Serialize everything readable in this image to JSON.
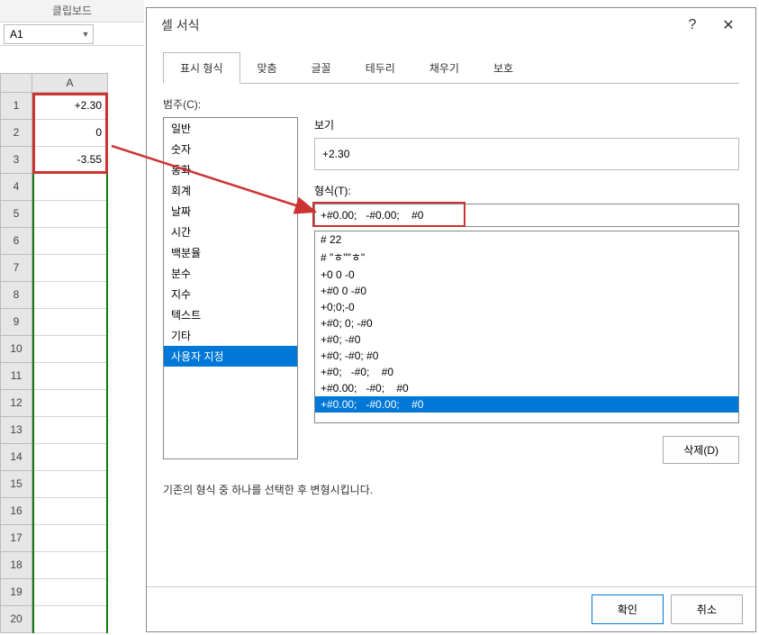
{
  "ribbon": {
    "clipboard_label": "클립보드"
  },
  "namebox": {
    "value": "A1"
  },
  "grid": {
    "col_header": "A",
    "rows": [
      "1",
      "2",
      "3",
      "4",
      "5",
      "6",
      "7",
      "8",
      "9",
      "10",
      "11",
      "12",
      "13",
      "14",
      "15",
      "16",
      "17",
      "18",
      "19",
      "20"
    ],
    "cells": [
      "+2.30",
      "0",
      "-3.55",
      "",
      "",
      "",
      "",
      "",
      "",
      "",
      "",
      "",
      "",
      "",
      "",
      "",
      "",
      "",
      "",
      ""
    ]
  },
  "dialog": {
    "title": "셀 서식",
    "help": "?",
    "close": "✕",
    "tabs": [
      "표시 형식",
      "맞춤",
      "글꼴",
      "테두리",
      "채우기",
      "보호"
    ],
    "active_tab": 0,
    "category_label": "범주(C):",
    "categories": [
      "일반",
      "숫자",
      "통화",
      "회계",
      "날짜",
      "시간",
      "백분율",
      "분수",
      "지수",
      "텍스트",
      "기타",
      "사용자 지정"
    ],
    "selected_category": 11,
    "preview_label": "보기",
    "preview_value": "+2.30",
    "format_label": "형식(T):",
    "format_input": "+#0.00;   -#0.00;    #0",
    "formats": [
      "# 22",
      "# \"ㅎ\"\"ㅎ\"",
      "+0 0 -0",
      "+#0 0 -#0",
      "+0;0;-0",
      "+#0; 0; -#0",
      "+#0; -#0",
      "+#0; -#0; #0",
      "+#0;   -#0;    #0",
      "+#0.00;   -#0;    #0",
      "+#0.00;   -#0.00;    #0"
    ],
    "selected_format": 10,
    "delete_label": "삭제(D)",
    "hint": "기존의 형식 중 하나를 선택한 후 변형시킵니다.",
    "ok_label": "확인",
    "cancel_label": "취소"
  }
}
